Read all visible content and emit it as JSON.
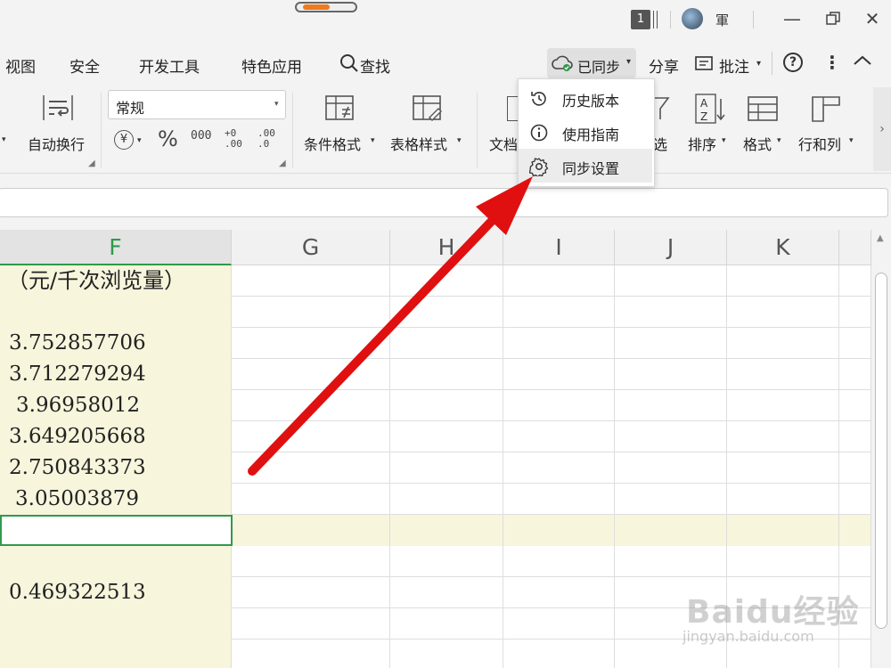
{
  "titlebar": {
    "tab_count": "1",
    "username": "軍"
  },
  "tabs": [
    "视图",
    "安全",
    "开发工具",
    "特色应用"
  ],
  "search_label": "查找",
  "sync": {
    "label": "已同步"
  },
  "share_label": "分享",
  "comment_label": "批注",
  "ribbon": {
    "wrap_label": "自动换行",
    "number_format": "常规",
    "currency_symbol": "¥",
    "percent_symbol": "%",
    "thousands_symbol": "000",
    "inc_decimal": "+0 .00",
    "dec_decimal": ".00 .0",
    "cond_format": "条件格式",
    "table_style": "表格样式",
    "doc_partial": "文档",
    "filter_partial": "选",
    "sort": "排序",
    "format": "格式",
    "rows_cols": "行和列"
  },
  "dropdown": {
    "items": [
      {
        "label": "历史版本",
        "icon": "history-icon"
      },
      {
        "label": "使用指南",
        "icon": "info-icon"
      },
      {
        "label": "同步设置",
        "icon": "gear-icon"
      }
    ],
    "hovered_index": 2
  },
  "grid": {
    "columns": [
      "F",
      "G",
      "H",
      "I",
      "J",
      "K"
    ],
    "selected_column": "F",
    "f_values": [
      "（元/千次浏览量）",
      "",
      "3.752857706",
      "3.712279294",
      "3.96958012",
      "3.649205668",
      "2.750843373",
      "3.05003879",
      "",
      "",
      "0.469322513",
      "",
      ""
    ]
  },
  "watermark": {
    "brand": "Baidu经验",
    "url": "jingyan.baidu.com"
  },
  "colors": {
    "accent_green": "#2f9a4a",
    "highlight_row": "#f7f5dc",
    "arrow_red": "#e01010"
  }
}
